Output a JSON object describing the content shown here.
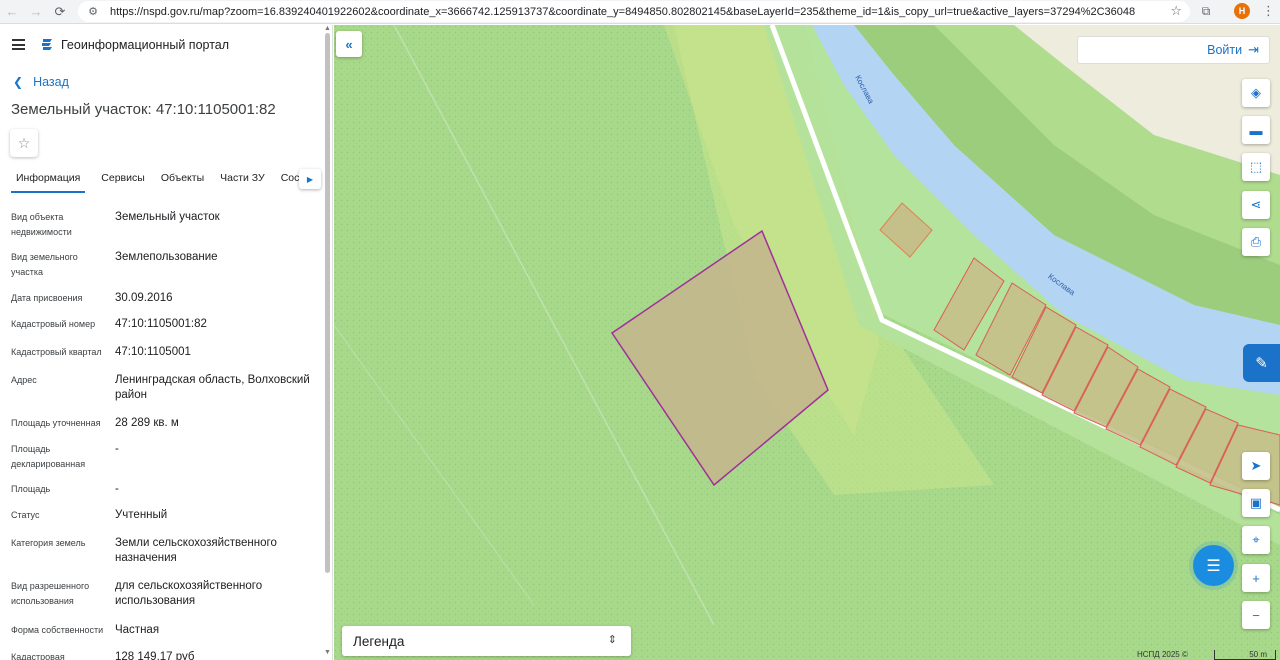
{
  "browser": {
    "url": "https://nspd.gov.ru/map?zoom=16.839240401922602&coordinate_x=3666742.125913737&coordinate_y=8494850.802802145&baseLayerId=235&theme_id=1&is_copy_url=true&active_layers=37294%2C36048",
    "profile_initial": "Н"
  },
  "header": {
    "portal_title": "Геоинформационный портал",
    "back_label": "Назад",
    "parcel_title": "Земельный участок: 47:10:1105001:82"
  },
  "tabs": [
    {
      "label": "Информация"
    },
    {
      "label": "Сервисы"
    },
    {
      "label": "Объекты"
    },
    {
      "label": "Части ЗУ"
    },
    {
      "label": "Соста"
    }
  ],
  "properties": [
    {
      "key": "Вид объекта недвижимости",
      "value": "Земельный участок"
    },
    {
      "key": "Вид земельного участка",
      "value": "Землепользование"
    },
    {
      "key": "Дата присвоения",
      "value": "30.09.2016"
    },
    {
      "key": "Кадастровый номер",
      "value": "47:10:1105001:82"
    },
    {
      "key": "Кадастровый квартал",
      "value": "47:10:1105001"
    },
    {
      "key": "Адрес",
      "value": "Ленинградская область, Волховский район"
    },
    {
      "key": "Площадь уточненная",
      "value": "28 289 кв. м"
    },
    {
      "key": "Площадь декларированная",
      "value": "-"
    },
    {
      "key": "Площадь",
      "value": "-"
    },
    {
      "key": "Статус",
      "value": "Учтенный"
    },
    {
      "key": "Категория земель",
      "value": "Земли сельскохозяйственного назначения"
    },
    {
      "key": "Вид разрешенного использования",
      "value": "для сельскохозяйственного использования"
    },
    {
      "key": "Форма собственности",
      "value": "Частная"
    },
    {
      "key": "Кадастровая",
      "value": "128 149,17 руб"
    }
  ],
  "map": {
    "login_label": "Войти",
    "legend_label": "Легенда",
    "river_name": "Кослава",
    "copyright": "НСПД 2025 ©",
    "scale_label": "50 m",
    "colors": {
      "meadow": "#b8e28a",
      "forest": "#a4d68c",
      "river": "#b4d4f4",
      "parcel_fill": "#c4b48c",
      "parcel_border": "#a0309a",
      "accent": "#1a73c8"
    }
  }
}
